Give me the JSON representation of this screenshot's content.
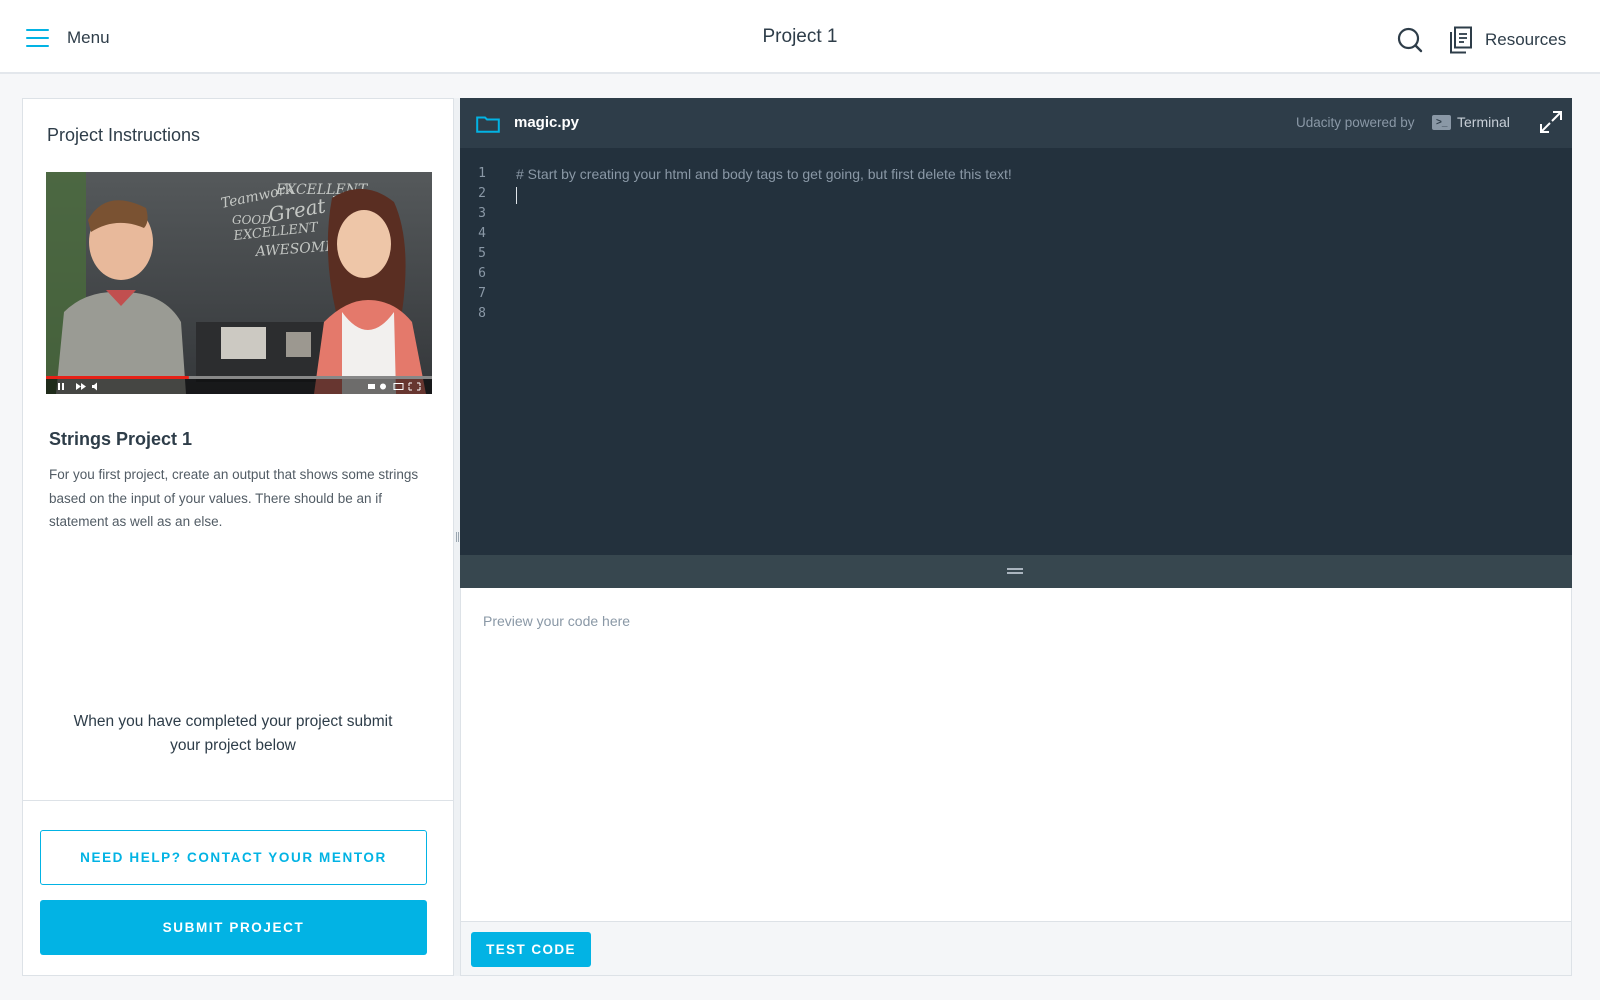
{
  "header": {
    "menu_label": "Menu",
    "title": "Project 1",
    "resources_label": "Resources",
    "icons": {
      "menu": "hamburger-icon",
      "search": "search-icon",
      "resources": "resources-icon"
    }
  },
  "instructions": {
    "heading": "Project Instructions",
    "project_name": "Strings Project 1",
    "description": "For you first project, create an output that shows some strings based on the input of your values. There should be an if statement as well as an else.",
    "complete_message": "When you have completed your project submit your project below",
    "help_button": "NEED HELP? CONTACT YOUR MENTOR",
    "submit_button": "SUBMIT PROJECT",
    "video": {
      "chalkboard_words": [
        "EXCELLENT",
        "Teamwork",
        "Great Job",
        "GOOD",
        "EXCELLENT",
        "AWESOME"
      ],
      "progress": 0.37
    }
  },
  "editor": {
    "file_name": "magic.py",
    "powered_by": "Udacity powered by",
    "terminal_badge": ">_",
    "terminal_label": "Terminal",
    "line_numbers": [
      "1",
      "2",
      "3",
      "4",
      "5",
      "6",
      "7",
      "8"
    ],
    "code_lines": [
      "# Start by creating your html and body tags to get going, but first delete this text!",
      "",
      "",
      "",
      "",
      "",
      "",
      ""
    ],
    "caret_line": 2
  },
  "preview": {
    "placeholder": "Preview your code here",
    "test_button": "TEST CODE"
  },
  "colors": {
    "accent": "#02b3e4",
    "editor_bg": "#23313d",
    "editor_header_bg": "#2e3d49",
    "text_dark": "#2e3d49"
  }
}
